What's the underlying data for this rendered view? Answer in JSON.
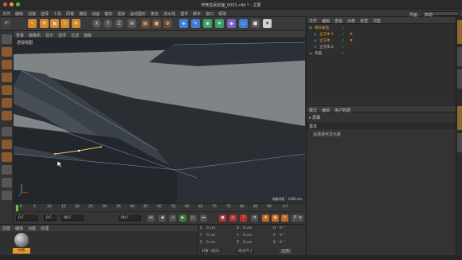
{
  "window": {
    "title": "甲壳虫而前面_0001.c4d * - 主要"
  },
  "menubar": {
    "items": [
      "文件",
      "编辑",
      "创建",
      "选择",
      "工具",
      "网格",
      "捕捉",
      "动画",
      "模拟",
      "渲染",
      "运动图形",
      "角色",
      "流水线",
      "插件",
      "脚本",
      "窗口",
      "帮助"
    ],
    "layout_label": "界面:",
    "layout_value": "启动"
  },
  "toolbar": {
    "buttons": [
      "undo",
      "select",
      "move",
      "scale",
      "rotate",
      "x-axis",
      "y-axis",
      "z-axis",
      "coord",
      "render-view",
      "render",
      "render-settings",
      "cube",
      "pen",
      "subdivide",
      "array",
      "deformer",
      "scene",
      "camera",
      "light"
    ],
    "axis_labels": [
      "X",
      "Y",
      "Z"
    ]
  },
  "viewport": {
    "menu": [
      "查看",
      "摄像机",
      "显示",
      "选项",
      "过滤",
      "面板"
    ],
    "label": "透视视图",
    "info": "网格间距 : 1000 cm"
  },
  "timeline": {
    "ticks": [
      "0",
      "5",
      "10",
      "15",
      "20",
      "25",
      "30",
      "35",
      "40",
      "45",
      "50",
      "55",
      "60",
      "65",
      "70",
      "75",
      "80",
      "85",
      "90"
    ],
    "frame_end": "0 F"
  },
  "transport": {
    "start": "0 F",
    "current": "0 F",
    "end": "90 F",
    "end2": "90 F"
  },
  "materials": {
    "menu": [
      "创建",
      "编辑",
      "功能",
      "纹理"
    ],
    "material_name": "材质"
  },
  "coords": {
    "rows": [
      {
        "a": "X",
        "av": "0 cm",
        "b": "X",
        "bv": "0 cm",
        "c": "H",
        "cv": "0 °"
      },
      {
        "a": "Y",
        "av": "0 cm",
        "b": "Y",
        "bv": "0 cm",
        "c": "P",
        "cv": "0 °"
      },
      {
        "a": "Z",
        "av": "0 cm",
        "b": "Z",
        "bv": "0 cm",
        "c": "B",
        "cv": "0 °"
      }
    ],
    "mode": "对象 (相对)",
    "size_mode": "绝对尺寸",
    "apply": "应用"
  },
  "objects": {
    "menu": [
      "文件",
      "编辑",
      "查看",
      "对象",
      "标签",
      "书签"
    ],
    "items": [
      {
        "name": "细分曲面",
        "color": "#e0a030",
        "indent": 0
      },
      {
        "name": "立方体.1",
        "color": "#e0a030",
        "indent": 1
      },
      {
        "name": "立方体",
        "color": "#e0a030",
        "indent": 1
      },
      {
        "name": "立方体.2",
        "color": "#c0c0c0",
        "indent": 1
      },
      {
        "name": "背面",
        "color": "#c0c0c0",
        "indent": 0
      }
    ]
  },
  "attributes": {
    "menu": [
      "模式",
      "编辑",
      "用户数据"
    ],
    "header": "屏幕",
    "section": "基本",
    "message": "没选择可见元素"
  },
  "colors": {
    "accent": "#e89a2c",
    "selected_text": "#e0a030",
    "viewport_bg": "#7f8587",
    "geometry": "#2a2e33"
  }
}
